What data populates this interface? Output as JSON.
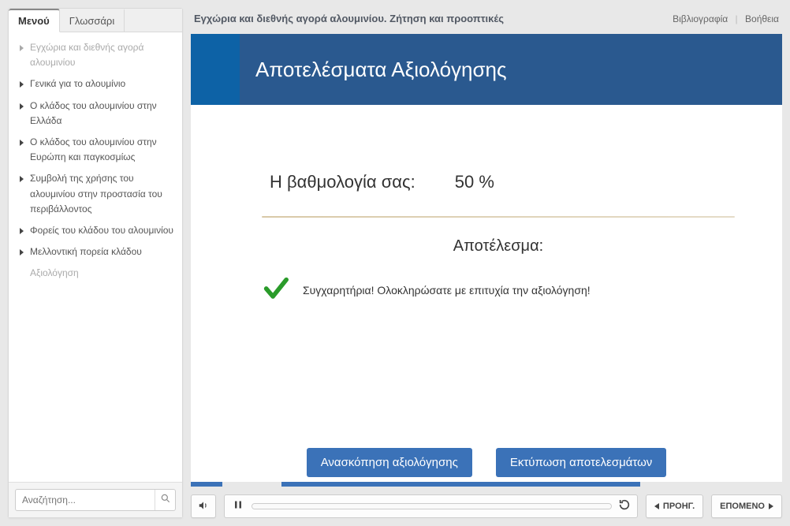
{
  "sidebar": {
    "tabs": {
      "menu": "Μενού",
      "glossary": "Γλωσσάρι"
    },
    "items": [
      {
        "label": "Εγχώρια και διεθνής αγορά αλουμινίου",
        "caret": true,
        "dim": true
      },
      {
        "label": "Γενικά για το αλουμίνιο",
        "caret": true,
        "dim": false
      },
      {
        "label": "Ο κλάδος του αλουμινίου στην Ελλάδα",
        "caret": true,
        "dim": false
      },
      {
        "label": "Ο κλάδος του αλουμινίου στην Ευρώπη και παγκοσμίως",
        "caret": true,
        "dim": false
      },
      {
        "label": "Συμβολή της χρήσης του αλουμινίου στην προστασία του περιβάλλοντος",
        "caret": true,
        "dim": false
      },
      {
        "label": "Φορείς του κλάδου του αλουμινίου",
        "caret": true,
        "dim": false
      },
      {
        "label": "Μελλοντική πορεία κλάδου",
        "caret": true,
        "dim": false
      },
      {
        "label": "Αξιολόγηση",
        "caret": false,
        "dim": true
      }
    ],
    "search_placeholder": "Αναζήτηση..."
  },
  "header": {
    "title": "Εγχώρια και διεθνής αγορά αλουμινίου. Ζήτηση και προοπτικές",
    "links": {
      "bibliography": "Βιβλιογραφία",
      "help": "Βοήθεια"
    }
  },
  "content": {
    "banner_title": "Αποτελέσματα Αξιολόγησης",
    "score_label": "Η βαθμολογία σας:",
    "score_value": "50 %",
    "result_heading": "Αποτέλεσμα:",
    "result_message": "Συγχαρητήρια! Ολοκληρώσατε με επιτυχία την αξιολόγηση!",
    "review_btn": "Ανασκόπηση αξιολόγησης",
    "print_btn": "Εκτύπωση αποτελεσμάτων"
  },
  "controls": {
    "prev": "ΠΡΟΗΓ.",
    "next": "ΕΠΟΜΕΝΟ"
  }
}
